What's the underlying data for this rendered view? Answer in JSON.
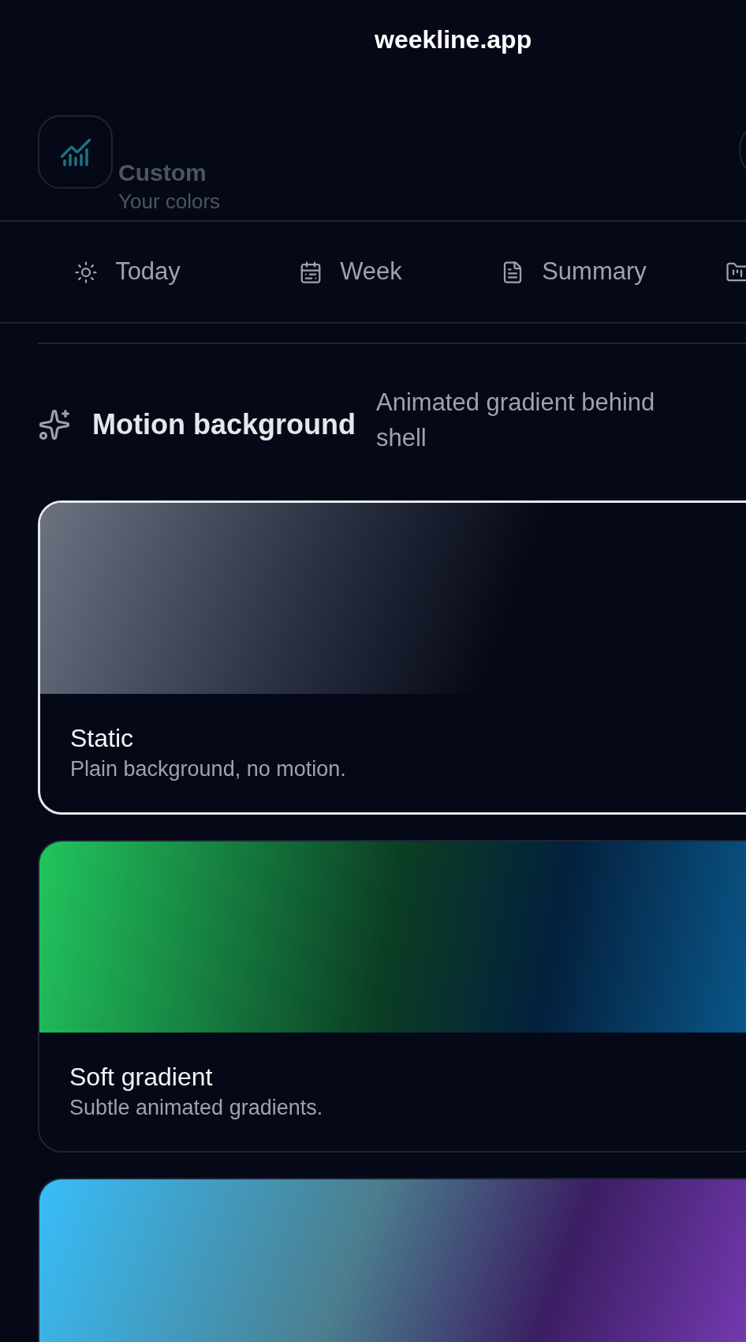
{
  "title": "weekline.app",
  "behind": {
    "title": "Custom",
    "subtitle": "Your colors"
  },
  "tabs": [
    {
      "label": "Today",
      "selected": false
    },
    {
      "label": "Week",
      "selected": false
    },
    {
      "label": "Summary",
      "selected": false
    },
    {
      "selected": false
    }
  ],
  "section": {
    "title": "Motion background",
    "description": "Animated gradient behind shell"
  },
  "options": [
    {
      "kind": "static",
      "title": "Static",
      "description": "Plain background, no motion.",
      "selected": true
    },
    {
      "kind": "soft",
      "title": "Soft gradient",
      "description": "Subtle animated gradients.",
      "selected": false
    },
    {
      "kind": "vivid",
      "selected": false
    }
  ]
}
